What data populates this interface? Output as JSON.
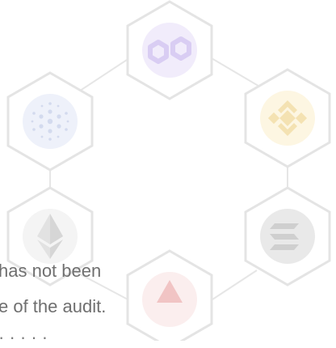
{
  "graphic": {
    "network": [
      {
        "id": "polygon",
        "icon": "polygon-logo-icon",
        "color": "#8247e5"
      },
      {
        "id": "binance",
        "icon": "binance-logo-icon",
        "color": "#f3ba2f"
      },
      {
        "id": "solana",
        "icon": "solana-logo-icon",
        "color": "#3a3a3a"
      },
      {
        "id": "avalanche",
        "icon": "avalanche-logo-icon",
        "color": "#e84142"
      },
      {
        "id": "ethereum",
        "icon": "ethereum-logo-icon",
        "color": "#627eea"
      },
      {
        "id": "cardano",
        "icon": "cardano-logo-icon",
        "color": "#0033ad"
      }
    ]
  },
  "text": {
    "line_1": "has not been",
    "line_2": "e of the audit.",
    "line_3": "· · · · ·"
  }
}
